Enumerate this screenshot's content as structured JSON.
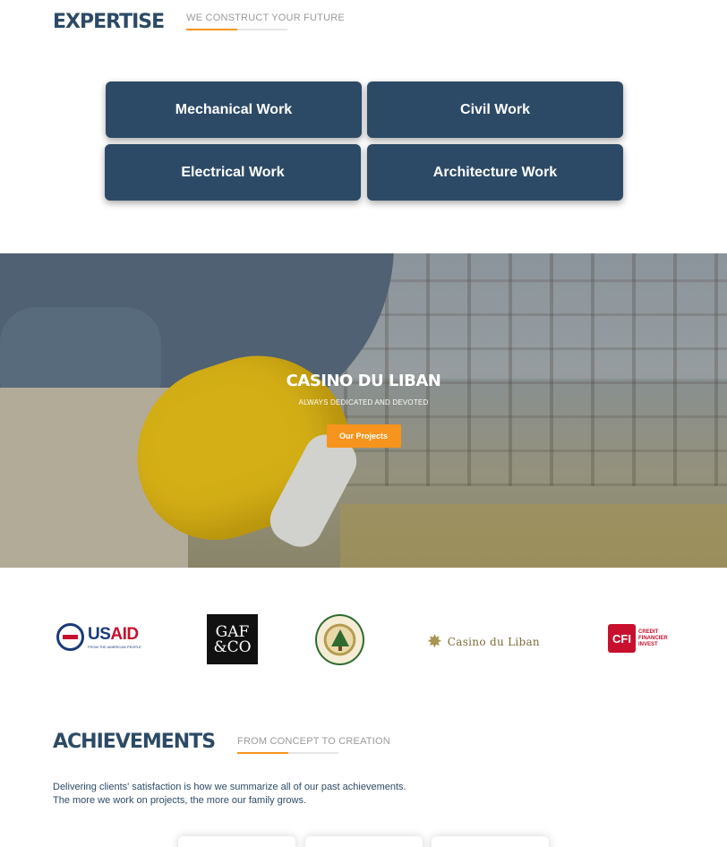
{
  "expertise": {
    "title": "EXPERTISE",
    "subtitle": "WE CONSTRUCT YOUR FUTURE",
    "buttons": [
      "Mechanical Work",
      "Civil Work",
      "Electrical Work",
      "Architecture Work"
    ]
  },
  "hero": {
    "title": "CASINO DU LIBAN",
    "tagline": "ALWAYS DEDICATED AND DEVOTED",
    "button_label": "Our Projects"
  },
  "partners": {
    "usaid": {
      "us": "US",
      "aid": "AID",
      "tag": "FROM THE AMERICAN PEOPLE"
    },
    "gaf": "GAF &CO",
    "casino": "Casino du Liban",
    "cfi": {
      "mark": "CFI",
      "text": "CREDIT FINANCIER INVEST"
    }
  },
  "achievements": {
    "title": "ACHIEVEMENTS",
    "subtitle": "FROM CONCEPT TO CREATION",
    "line1": "Delivering clients' satisfaction is how we summarize all of our past achievements.",
    "line2": "The more we work on projects, the more our family grows."
  },
  "colors": {
    "primary": "#2c4a66",
    "accent": "#f7941d"
  }
}
